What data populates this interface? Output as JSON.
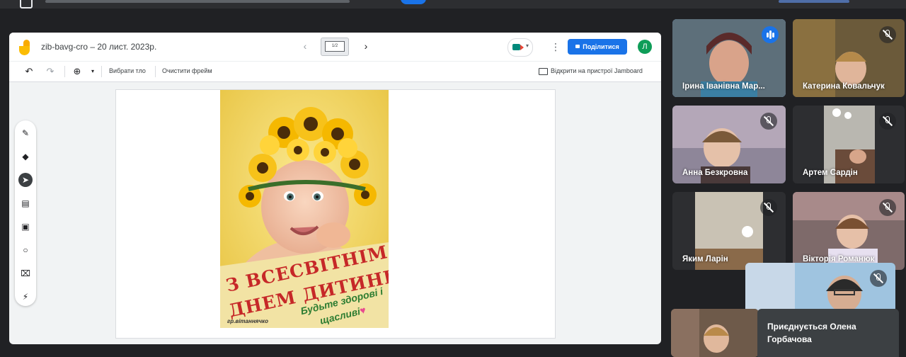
{
  "jamboard": {
    "title": "zib-bavg-cro – 20 лист. 2023р.",
    "frame_indicator": "1/2",
    "share_label": "Поділитися",
    "user_initial": "Л",
    "toolbar": {
      "select_all": "Вибрати тло",
      "clear_frame": "Очистити фрейм",
      "open_on_device": "Відкрити на пристрої Jamboard"
    },
    "tools": [
      "pen-tool",
      "eraser-tool",
      "select-tool",
      "sticky-note-tool",
      "image-tool",
      "circle-tool",
      "text-box-tool",
      "laser-tool"
    ],
    "poster": {
      "headline_line1": "З всесвітнім",
      "headline_line2": "днем дитини",
      "wish_line1": "Будьте здорові і",
      "wish_line2": "щасливі",
      "credit": "гр.вітаннячко",
      "colors": {
        "background": "#f3d96a",
        "banner": "#f2e3a4",
        "headline": "#c62828",
        "wish": "#2e7d32"
      }
    }
  },
  "participants": [
    {
      "name": "Ірина Іванівна Мар...",
      "speaking": true
    },
    {
      "name": "Катерина Ковальчук",
      "muted": true
    },
    {
      "name": "Анна Безкровна",
      "muted": true
    },
    {
      "name": "Артем Сардін",
      "muted": true
    },
    {
      "name": "Яким Ларін",
      "muted": true
    },
    {
      "name": "Вікторія Романюк",
      "muted": true
    }
  ],
  "join_notice": "Приєднується Олена Горбачова",
  "colors": {
    "accent": "#1a73e8",
    "meet_bg": "#202124"
  }
}
